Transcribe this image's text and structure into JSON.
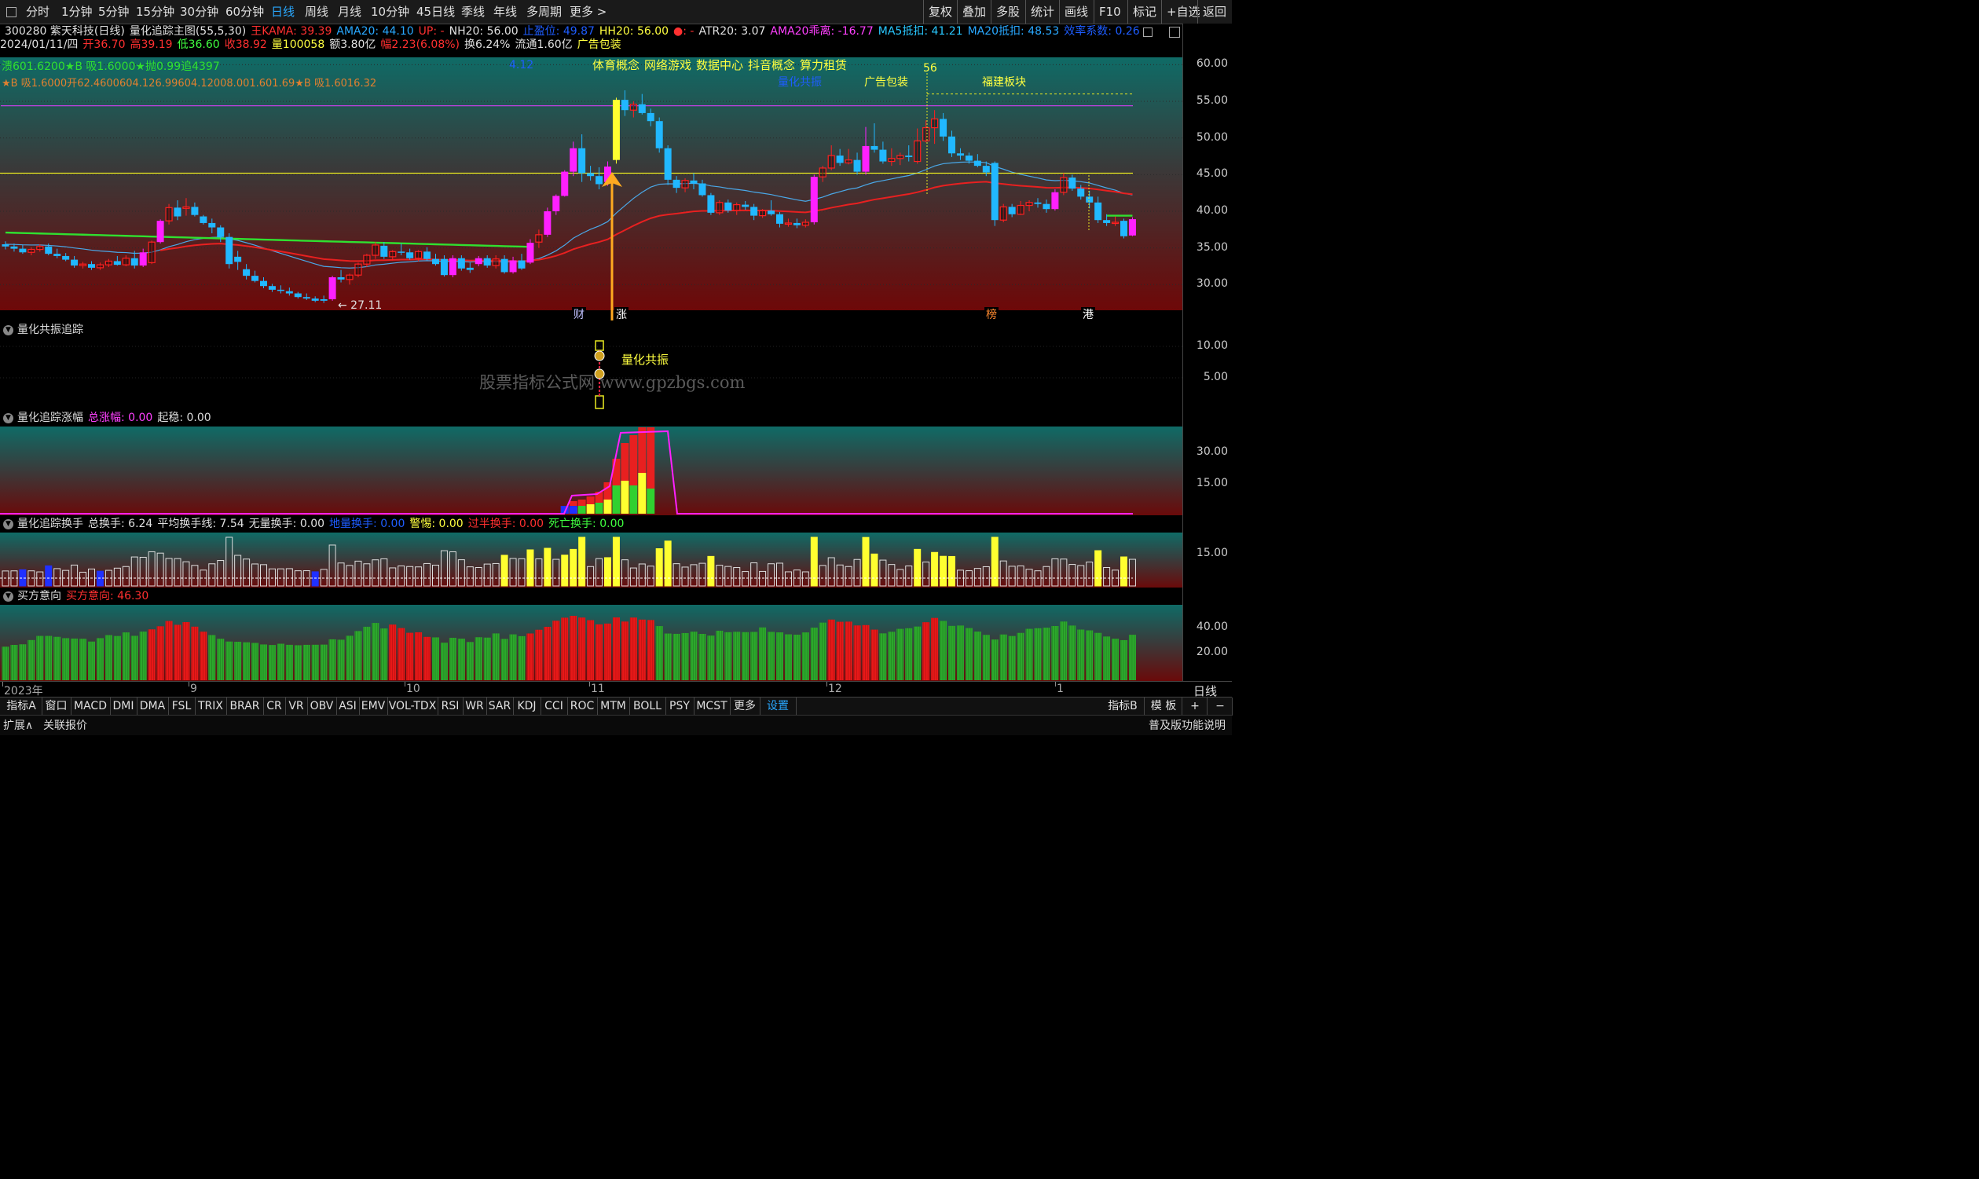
{
  "toolbar": {
    "periods": [
      "分时",
      "1分钟",
      "5分钟",
      "15分钟",
      "30分钟",
      "60分钟",
      "日线",
      "周线",
      "月线",
      "10分钟",
      "45日线",
      "季线",
      "年线",
      "多周期",
      "更多 >"
    ],
    "active_period": "日线",
    "right_buttons": [
      "复权",
      "叠加",
      "多股",
      "统计",
      "画线",
      "F10",
      "标记",
      "+自选",
      "返回"
    ]
  },
  "info1": [
    {
      "t": "300280 紫天科技(日线)",
      "c": "#e0e0e0"
    },
    {
      "t": "量化追踪主图(55,5,30)",
      "c": "#e0e0e0"
    },
    {
      "t": "王KAMA: 39.39",
      "c": "#ff3030"
    },
    {
      "t": "AMA20: 44.10",
      "c": "#29a8ff"
    },
    {
      "t": "UP: -",
      "c": "#ff3030"
    },
    {
      "t": "NH20: 56.00",
      "c": "#e0e0e0"
    },
    {
      "t": "止盈位: 49.87",
      "c": "#1e5dff"
    },
    {
      "t": "HH20: 56.00",
      "c": "#ffff40"
    },
    {
      "t": "●: -",
      "c": "#ff3030"
    },
    {
      "t": "ATR20: 3.07",
      "c": "#e0e0e0"
    },
    {
      "t": "AMA20乖离: -16.77",
      "c": "#ff40ff"
    },
    {
      "t": "MA5抵扣: 41.21",
      "c": "#29c8ff"
    },
    {
      "t": "MA20抵扣: 48.53",
      "c": "#29a8ff"
    },
    {
      "t": "效率系数: 0.26",
      "c": "#1e5dff"
    }
  ],
  "info2": [
    {
      "t": "2024/01/11/四",
      "c": "#e0e0e0"
    },
    {
      "t": "开36.70",
      "c": "#ff3030"
    },
    {
      "t": "高39.19",
      "c": "#ff3030"
    },
    {
      "t": "低36.60",
      "c": "#40ff40"
    },
    {
      "t": "收38.92",
      "c": "#ff3030"
    },
    {
      "t": "量100058",
      "c": "#ffff40"
    },
    {
      "t": "额3.80亿",
      "c": "#e0e0e0"
    },
    {
      "t": "幅2.23(6.08%)",
      "c": "#ff3030"
    },
    {
      "t": "换6.24%",
      "c": "#e0e0e0"
    },
    {
      "t": "流通1.60亿",
      "c": "#e0e0e0"
    },
    {
      "t": "广告包装",
      "c": "#ffff40"
    }
  ],
  "main_chart": {
    "legend_line1": "溃601.6200★B 吸1.6000★抛0.99追4397",
    "legend_line2": "★B 吸1.6000开62.4600604.126.99604.12008.001.601.69★B 吸1.6016.32",
    "y_ticks": [
      "60.00",
      "55.00",
      "50.00",
      "45.00",
      "40.00",
      "35.00",
      "30.00"
    ],
    "y_range": [
      26.5,
      61
    ],
    "concept_tags": [
      "体育概念",
      "网络游戏",
      "数据中心",
      "抖音概念",
      "算力租赁"
    ],
    "annotations": [
      {
        "t": "4.12",
        "c": "#1e5dff"
      },
      {
        "t": "量化共振",
        "c": "#1e5dff"
      },
      {
        "t": "广告包装",
        "c": "#ffff40"
      },
      {
        "t": "福建板块",
        "c": "#ffff40"
      },
      {
        "t": "56",
        "c": "#ffff40"
      },
      {
        "t": "← 27.11",
        "c": "#e0e0e0"
      }
    ],
    "event_badges": [
      "财",
      "涨",
      "榜",
      "港"
    ],
    "yellow_level": 45.2,
    "magenta_level": 54.4,
    "high_dotted_level": 56
  },
  "panel_resonance": {
    "title": "量化共振追踪",
    "y_ticks": [
      "10.00",
      "5.00"
    ],
    "label": "量化共振",
    "watermark": "股票指标公式网 www.gpzbgs.com"
  },
  "panel_rise": {
    "title": "量化追踪涨幅",
    "total_label": "总涨幅: 0.00",
    "stable_label": "起稳: 0.00",
    "y_ticks": [
      "30.00",
      "15.00"
    ]
  },
  "panel_turnover": {
    "title": "量化追踪换手",
    "items": [
      {
        "t": "总换手: 6.24",
        "c": "#e0e0e0"
      },
      {
        "t": "平均换手线: 7.54",
        "c": "#e0e0e0"
      },
      {
        "t": "无量换手: 0.00",
        "c": "#e0e0e0"
      },
      {
        "t": "地量换手: 0.00",
        "c": "#1e5dff"
      },
      {
        "t": "警惕: 0.00",
        "c": "#ffff40"
      },
      {
        "t": "过半换手: 0.00",
        "c": "#ff3030"
      },
      {
        "t": "死亡换手: 0.00",
        "c": "#40ff40"
      }
    ],
    "y_ticks": [
      "15.00"
    ]
  },
  "panel_buyer": {
    "title": "买方意向",
    "value_label": "买方意向: 46.30",
    "y_ticks": [
      "40.00",
      "20.00"
    ]
  },
  "x_axis": {
    "labels": [
      "2023年",
      "9",
      "10",
      "11",
      "12",
      "1"
    ],
    "period": "日线"
  },
  "indicator_tabs": [
    "指标A",
    "窗口",
    "MACD",
    "DMI",
    "DMA",
    "FSL",
    "TRIX",
    "BRAR",
    "CR",
    "VR",
    "OBV",
    "ASI",
    "EMV",
    "VOL-TDX",
    "RSI",
    "WR",
    "SAR",
    "KDJ",
    "CCI",
    "ROC",
    "MTM",
    "BOLL",
    "PSY",
    "MCST",
    "更多",
    "设置"
  ],
  "active_tab": "设置",
  "tabs_right": [
    "指标B",
    "模 板",
    "+",
    "−"
  ],
  "bottom_left": [
    "扩展∧",
    "关联报价"
  ],
  "bottom_right": "普及版功能说明",
  "colors": {
    "up": "#ff2020",
    "down": "#21b8ff",
    "limit_up": "#ff20ff",
    "yellow": "#ffff30",
    "green": "#30d030"
  },
  "chart_data": {
    "type": "candlestick",
    "candles": [
      [
        35.5,
        35.9,
        34.8,
        35.2
      ],
      [
        35.2,
        35.6,
        34.5,
        34.9
      ],
      [
        34.9,
        35.4,
        34.2,
        34.4
      ],
      [
        34.4,
        35.1,
        34.0,
        34.8
      ],
      [
        34.8,
        35.5,
        34.5,
        35.2
      ],
      [
        35.2,
        35.6,
        34.0,
        34.2
      ],
      [
        34.2,
        34.9,
        33.6,
        33.9
      ],
      [
        33.9,
        34.3,
        33.2,
        33.4
      ],
      [
        33.4,
        33.9,
        32.3,
        32.6
      ],
      [
        32.6,
        33.1,
        32.2,
        32.8
      ],
      [
        32.8,
        33.2,
        32.0,
        32.3
      ],
      [
        32.3,
        33.0,
        32.0,
        32.7
      ],
      [
        32.7,
        33.5,
        32.4,
        33.2
      ],
      [
        33.2,
        33.9,
        32.6,
        32.7
      ],
      [
        32.7,
        34.0,
        32.5,
        33.6
      ],
      [
        33.6,
        34.6,
        32.2,
        32.6
      ],
      [
        32.6,
        34.9,
        32.4,
        34.4
      ],
      [
        33.0,
        36.0,
        32.8,
        35.8
      ],
      [
        35.8,
        38.9,
        35.6,
        38.7
      ],
      [
        38.7,
        41.0,
        38.2,
        40.5
      ],
      [
        40.5,
        41.5,
        38.8,
        39.3
      ],
      [
        40.4,
        41.8,
        39.4,
        40.6
      ],
      [
        40.6,
        41.2,
        39.3,
        39.5
      ],
      [
        39.3,
        39.5,
        38.2,
        38.4
      ],
      [
        38.4,
        39.0,
        37.0,
        37.8
      ],
      [
        37.8,
        38.1,
        35.8,
        36.5
      ],
      [
        36.5,
        37.0,
        32.2,
        32.8
      ],
      [
        33.8,
        34.6,
        32.0,
        33.1
      ],
      [
        32.1,
        32.8,
        30.7,
        31.2
      ],
      [
        31.2,
        31.9,
        30.3,
        30.5
      ],
      [
        30.5,
        31.0,
        29.5,
        29.8
      ],
      [
        29.8,
        30.1,
        29.0,
        29.3
      ],
      [
        29.3,
        29.9,
        28.8,
        29.2
      ],
      [
        29.1,
        29.6,
        28.5,
        28.8
      ],
      [
        28.8,
        29.0,
        28.1,
        28.3
      ],
      [
        28.3,
        28.8,
        27.9,
        28.1
      ],
      [
        28.1,
        28.4,
        27.6,
        27.8
      ],
      [
        28.0,
        28.5,
        27.5,
        27.8
      ],
      [
        28.0,
        31.2,
        27.8,
        31.0
      ],
      [
        31.0,
        32.0,
        30.3,
        30.7
      ],
      [
        30.7,
        31.5,
        30.0,
        31.3
      ],
      [
        31.3,
        33.0,
        31.0,
        32.8
      ],
      [
        32.8,
        34.2,
        32.4,
        34.0
      ],
      [
        34.0,
        35.8,
        33.5,
        35.4
      ],
      [
        35.3,
        35.8,
        33.5,
        33.8
      ],
      [
        33.8,
        34.7,
        33.3,
        34.5
      ],
      [
        34.5,
        35.6,
        34.0,
        34.4
      ],
      [
        34.4,
        34.9,
        33.4,
        33.6
      ],
      [
        33.6,
        34.7,
        33.2,
        34.5
      ],
      [
        34.5,
        35.1,
        33.3,
        33.5
      ],
      [
        33.5,
        34.2,
        32.6,
        32.8
      ],
      [
        33.5,
        34.0,
        31.1,
        31.3
      ],
      [
        31.3,
        34.0,
        31.0,
        33.6
      ],
      [
        33.6,
        34.0,
        31.9,
        32.2
      ],
      [
        32.3,
        33.0,
        31.6,
        32.0
      ],
      [
        32.8,
        33.9,
        32.5,
        33.6
      ],
      [
        33.6,
        34.0,
        32.3,
        32.6
      ],
      [
        32.6,
        34.0,
        32.2,
        33.5
      ],
      [
        33.5,
        34.0,
        31.5,
        31.7
      ],
      [
        31.7,
        33.8,
        31.5,
        33.3
      ],
      [
        33.3,
        34.2,
        32.0,
        32.2
      ],
      [
        33.0,
        36.2,
        32.8,
        35.7
      ],
      [
        35.8,
        37.5,
        35.0,
        36.8
      ],
      [
        36.8,
        40.5,
        36.5,
        40.0
      ],
      [
        40.0,
        42.3,
        39.5,
        42.1
      ],
      [
        42.1,
        45.6,
        42.0,
        45.4
      ],
      [
        45.4,
        49.5,
        44.8,
        48.6
      ],
      [
        48.6,
        50.5,
        44.0,
        45.2
      ],
      [
        45.2,
        46.2,
        44.2,
        44.8
      ],
      [
        44.8,
        46.0,
        43.0,
        43.7
      ],
      [
        44.0,
        46.8,
        43.5,
        46.1
      ],
      [
        47.0,
        55.5,
        46.5,
        55.2
      ],
      [
        55.2,
        56.5,
        53.0,
        53.8
      ],
      [
        53.8,
        55.0,
        52.8,
        54.6
      ],
      [
        54.6,
        56.0,
        53.2,
        53.4
      ],
      [
        53.4,
        54.0,
        51.6,
        52.3
      ],
      [
        52.3,
        52.8,
        48.0,
        48.6
      ],
      [
        48.6,
        49.0,
        43.6,
        44.3
      ],
      [
        44.3,
        44.8,
        42.5,
        43.2
      ],
      [
        43.2,
        44.5,
        42.6,
        44.2
      ],
      [
        44.2,
        45.2,
        43.0,
        43.8
      ],
      [
        43.8,
        44.3,
        42.0,
        42.2
      ],
      [
        42.2,
        42.5,
        39.5,
        39.8
      ],
      [
        39.8,
        41.5,
        39.5,
        41.2
      ],
      [
        41.2,
        41.6,
        39.8,
        40.1
      ],
      [
        40.1,
        41.2,
        39.5,
        40.9
      ],
      [
        40.9,
        41.4,
        40.2,
        40.6
      ],
      [
        40.6,
        41.0,
        38.8,
        39.4
      ],
      [
        39.4,
        40.3,
        39.1,
        40.1
      ],
      [
        40.1,
        41.5,
        39.4,
        39.6
      ],
      [
        39.6,
        39.9,
        37.8,
        38.3
      ],
      [
        38.3,
        39.0,
        37.9,
        38.4
      ],
      [
        38.4,
        39.0,
        37.7,
        38.1
      ],
      [
        38.1,
        38.9,
        37.8,
        38.5
      ],
      [
        38.5,
        45.0,
        38.2,
        44.7
      ],
      [
        44.7,
        46.2,
        44.0,
        45.9
      ],
      [
        45.9,
        49.0,
        45.6,
        47.6
      ],
      [
        47.6,
        48.5,
        46.2,
        46.6
      ],
      [
        46.6,
        48.5,
        46.4,
        47.0
      ],
      [
        47.0,
        48.0,
        45.0,
        45.4
      ],
      [
        45.4,
        51.5,
        45.0,
        48.9
      ],
      [
        48.9,
        52.0,
        48.0,
        48.4
      ],
      [
        48.4,
        49.5,
        46.5,
        46.8
      ],
      [
        46.8,
        48.6,
        46.2,
        47.2
      ],
      [
        47.2,
        48.0,
        46.3,
        47.6
      ],
      [
        47.6,
        49.0,
        46.8,
        47.4
      ],
      [
        46.8,
        51.3,
        46.5,
        49.6
      ],
      [
        49.6,
        52.4,
        49.4,
        51.4
      ],
      [
        51.4,
        53.8,
        49.2,
        52.6
      ],
      [
        52.6,
        53.4,
        49.6,
        50.2
      ],
      [
        50.2,
        51.0,
        47.4,
        47.9
      ],
      [
        47.9,
        48.6,
        47.0,
        47.6
      ],
      [
        47.6,
        48.0,
        46.5,
        46.9
      ],
      [
        46.9,
        47.8,
        46.0,
        46.2
      ],
      [
        46.2,
        46.8,
        44.8,
        45.3
      ],
      [
        46.6,
        46.8,
        38.0,
        38.8
      ],
      [
        38.8,
        41.0,
        38.5,
        40.6
      ],
      [
        40.6,
        41.0,
        39.2,
        39.6
      ],
      [
        39.6,
        41.4,
        39.5,
        40.8
      ],
      [
        40.8,
        41.5,
        40.0,
        41.2
      ],
      [
        41.2,
        41.8,
        40.5,
        41.0
      ],
      [
        41.0,
        41.6,
        39.8,
        40.3
      ],
      [
        40.3,
        43.0,
        40.1,
        42.6
      ],
      [
        42.6,
        45.2,
        42.2,
        44.6
      ],
      [
        44.6,
        45.0,
        42.8,
        43.1
      ],
      [
        43.1,
        43.6,
        41.6,
        42.0
      ],
      [
        42.0,
        42.8,
        40.4,
        41.2
      ],
      [
        41.2,
        42.0,
        38.4,
        38.8
      ],
      [
        38.8,
        39.6,
        38.0,
        38.4
      ],
      [
        38.4,
        39.3,
        38.0,
        38.5
      ],
      [
        38.7,
        39.0,
        36.3,
        36.6
      ],
      [
        36.7,
        39.19,
        36.6,
        38.92
      ]
    ],
    "sell_resonance_marker": {
      "bar_index": 68,
      "label": "量化共振"
    },
    "buyer_intent_last": 46.3
  }
}
